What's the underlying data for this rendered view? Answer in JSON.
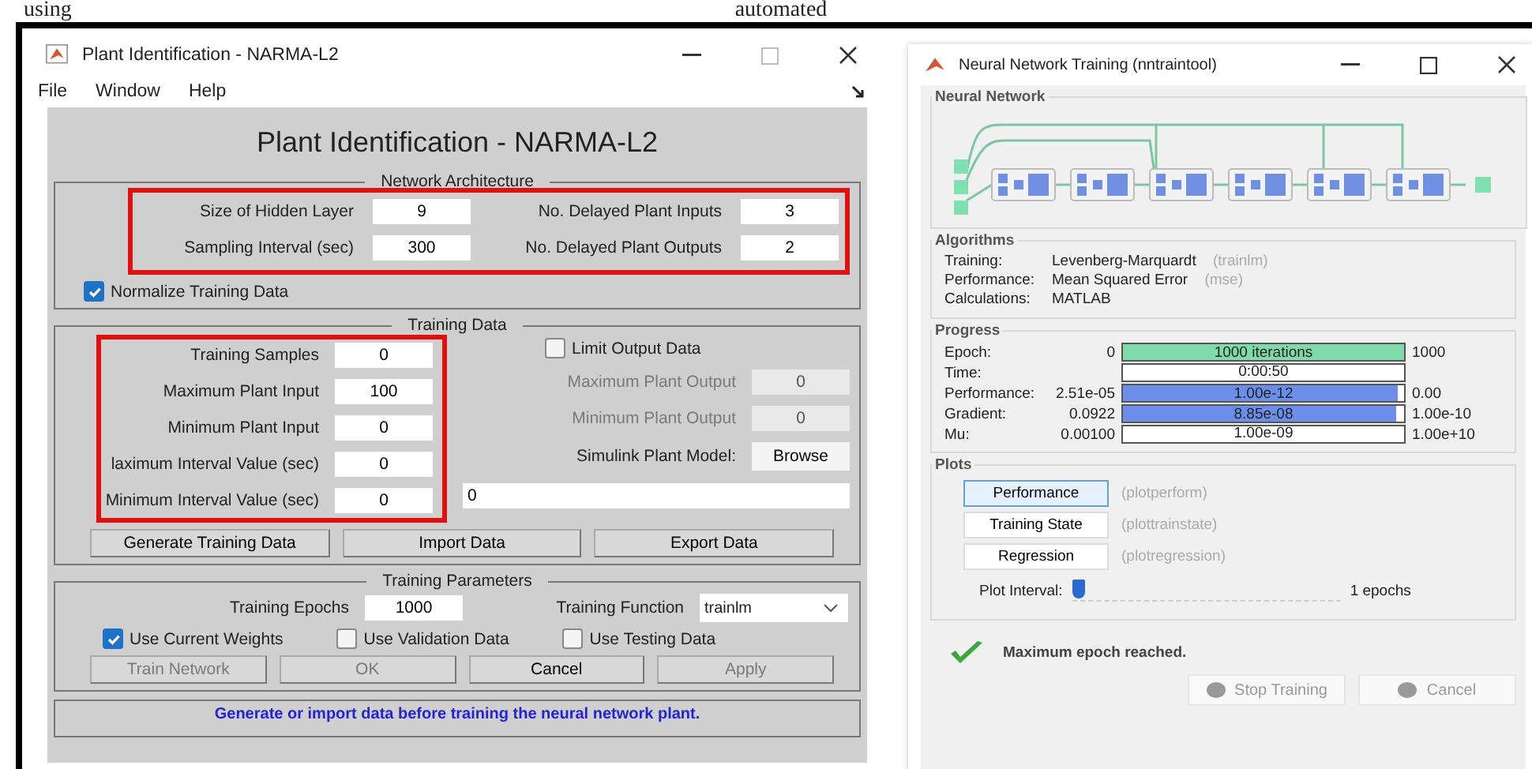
{
  "caption_fragments": [
    "using",
    "automated"
  ],
  "plant_window": {
    "title": "Plant Identification - NARMA-L2",
    "menu": [
      "File",
      "Window",
      "Help"
    ],
    "heading": "Plant Identification - NARMA-L2",
    "architecture": {
      "title": "Network Architecture",
      "fields": [
        {
          "label": "Size of Hidden Layer",
          "value": "9"
        },
        {
          "label": "No. Delayed Plant Inputs",
          "value": "3"
        },
        {
          "label": "Sampling Interval (sec)",
          "value": "300"
        },
        {
          "label": "No. Delayed Plant Outputs",
          "value": "2"
        }
      ],
      "normalize": {
        "label": "Normalize Training Data",
        "checked": true
      }
    },
    "training_data": {
      "title": "Training Data",
      "fields": [
        {
          "label": "Training Samples",
          "value": "0"
        },
        {
          "label": "Maximum Plant Input",
          "value": "100"
        },
        {
          "label": "Minimum Plant Input",
          "value": "0"
        },
        {
          "label": "laximum Interval Value (sec)",
          "value": "0"
        },
        {
          "label": "Minimum Interval Value (sec)",
          "value": "0"
        }
      ],
      "limit_output": {
        "label": "Limit Output Data",
        "checked": false
      },
      "output_fields": [
        {
          "label": "Maximum Plant Output",
          "value": "0",
          "disabled": true
        },
        {
          "label": "Minimum Plant Output",
          "value": "0",
          "disabled": true
        }
      ],
      "simulink": {
        "label": "Simulink Plant Model:",
        "button": "Browse"
      },
      "model_path": "0",
      "buttons": [
        {
          "label": "Generate Training Data",
          "disabled": false
        },
        {
          "label": "Import Data",
          "disabled": false
        },
        {
          "label": "Export Data",
          "disabled": false
        }
      ]
    },
    "training_parameters": {
      "title": "Training Parameters",
      "epochs": {
        "label": "Training Epochs",
        "value": "1000"
      },
      "function": {
        "label": "Training Function",
        "value": "trainlm"
      },
      "checks": [
        {
          "label": "Use Current Weights",
          "checked": true
        },
        {
          "label": "Use Validation Data",
          "checked": false
        },
        {
          "label": "Use Testing Data",
          "checked": false
        }
      ],
      "buttons": [
        {
          "label": "Train Network",
          "disabled": true
        },
        {
          "label": "OK",
          "disabled": true
        },
        {
          "label": "Cancel",
          "disabled": false
        },
        {
          "label": "Apply",
          "disabled": true
        }
      ]
    },
    "status": "Generate or import data before training the neural network plant."
  },
  "training_window": {
    "title": "Neural Network Training (nntraintool)",
    "network": {
      "title": "Neural Network"
    },
    "algorithms": {
      "title": "Algorithms",
      "rows": [
        {
          "label": "Training:",
          "value": "Levenberg-Marquardt",
          "note": "(trainlm)"
        },
        {
          "label": "Performance:",
          "value": "Mean Squared Error",
          "note": "(mse)"
        },
        {
          "label": "Calculations:",
          "value": "MATLAB"
        }
      ]
    },
    "progress": {
      "title": "Progress",
      "rows": [
        {
          "kind": "bar",
          "label": "Epoch:",
          "start": "0",
          "bar_text": "1000 iterations",
          "level": 1,
          "color": "#7fdcaa",
          "end": "1000"
        },
        {
          "kind": "value",
          "label": "Time:",
          "bar_text": "0:00:50"
        },
        {
          "kind": "bar",
          "label": "Performance:",
          "start": "2.51e-05",
          "bar_text": "1.00e-12",
          "level": 0.98,
          "color": "#6b8ee8",
          "end": "0.00"
        },
        {
          "kind": "bar",
          "label": "Gradient:",
          "start": "0.0922",
          "bar_text": "8.85e-08",
          "level": 0.97,
          "color": "#6b8ee8",
          "end": "1.00e-10"
        },
        {
          "kind": "value",
          "label": "Mu:",
          "start": "0.00100",
          "bar_text": "1.00e-09",
          "end": "1.00e+10"
        }
      ]
    },
    "plots": {
      "title": "Plots",
      "buttons": [
        {
          "label": "Performance",
          "note": "(plotperform)",
          "selected": true
        },
        {
          "label": "Training State",
          "note": "(plottrainstate)",
          "selected": false
        },
        {
          "label": "Regression",
          "note": "(plotregression)",
          "selected": false
        }
      ],
      "interval": {
        "label": "Plot Interval:",
        "level": 0,
        "reading": "1 epochs"
      }
    },
    "message": "Maximum epoch reached.",
    "buttons": [
      {
        "label": "Stop Training",
        "disabled": true
      },
      {
        "label": "Cancel",
        "disabled": true
      }
    ]
  }
}
